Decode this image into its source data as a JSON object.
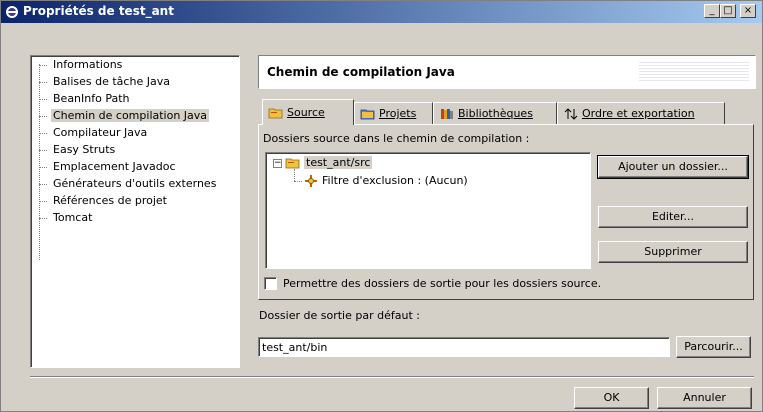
{
  "window": {
    "title": "Propriétés de test_ant",
    "controls": {
      "minimize": "_",
      "maximize": "□",
      "close": "×"
    }
  },
  "nav": {
    "items": [
      {
        "label": "Informations",
        "selected": false
      },
      {
        "label": "Balises de tâche Java",
        "selected": false
      },
      {
        "label": "BeanInfo Path",
        "selected": false
      },
      {
        "label": "Chemin de compilation Java",
        "selected": true
      },
      {
        "label": "Compilateur Java",
        "selected": false
      },
      {
        "label": "Easy Struts",
        "selected": false
      },
      {
        "label": "Emplacement Javadoc",
        "selected": false
      },
      {
        "label": "Générateurs d'outils externes",
        "selected": false
      },
      {
        "label": "Références de projet",
        "selected": false
      },
      {
        "label": "Tomcat",
        "selected": false
      }
    ]
  },
  "page": {
    "title": "Chemin de compilation Java"
  },
  "tabs": [
    {
      "label": "Source",
      "icon": "folder-source-icon",
      "active": true
    },
    {
      "label": "Projets",
      "icon": "folder-project-icon",
      "active": false
    },
    {
      "label": "Bibliothèques",
      "icon": "library-books-icon",
      "active": false
    },
    {
      "label": "Ordre et exportation",
      "icon": "order-arrows-icon",
      "active": false
    }
  ],
  "source": {
    "section_label": "Dossiers source dans le chemin de compilation :",
    "tree": {
      "root_label": "test_ant/src",
      "child_label": "Filtre d'exclusion : (Aucun)",
      "expander": "−"
    },
    "buttons": {
      "add": "Ajouter un dossier...",
      "edit": "Editer...",
      "remove": "Supprimer"
    },
    "checkbox_label": "Permettre des dossiers de sortie pour les dossiers source.",
    "checkbox_checked": false
  },
  "output": {
    "label": "Dossier de sortie par défaut :",
    "value": "test_ant/bin",
    "browse": "Parcourir..."
  },
  "dialog_buttons": {
    "ok": "OK",
    "cancel": "Annuler"
  },
  "colors": {
    "titlebar_start": "#0a246a",
    "titlebar_end": "#a6caf0",
    "face": "#d4d0c8",
    "folder": "#f0c040"
  }
}
